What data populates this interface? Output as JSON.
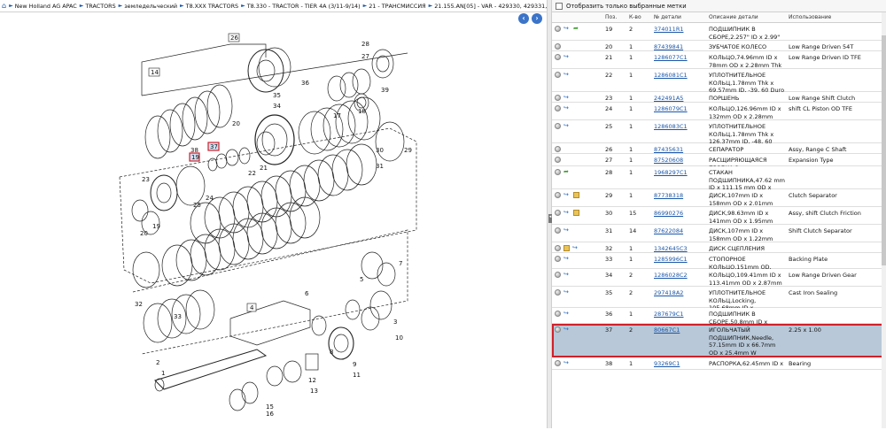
{
  "breadcrumb": {
    "items": [
      "New Holland AG APAC",
      "TRACTORS",
      "земледельческий",
      "T8.XXX TRACTORS",
      "T8.330 - TRACTOR - TIER 4A (3/11-9/14)",
      "21 - ТРАНСМИССИЯ",
      "21.155.AN[05] - VAR - 429330, 429331, 429..."
    ]
  },
  "filter": {
    "label": "Отобразить только выбранные метки"
  },
  "table": {
    "headers": {
      "pos": "Поз.",
      "qty": "К-во",
      "num": "№ детали",
      "desc": "Описание детали",
      "use": "Использование"
    },
    "rows": [
      {
        "pos": "19",
        "qty": "2",
        "num": "374011R1",
        "desc": "ПОДШИПНИК В СБОРЕ,2.257\" ID x 2.99\" OD",
        "use": "",
        "icons": [
          "dot",
          "arrow",
          "green"
        ]
      },
      {
        "pos": "20",
        "qty": "1",
        "num": "87439841",
        "desc": "ЗУБЧАТОЕ КОЛЕСО",
        "use": "Low Range Driven 54T",
        "icons": [
          "dot"
        ]
      },
      {
        "pos": "21",
        "qty": "1",
        "num": "1286077C1",
        "desc": "КОЛЬЦО,74.96mm ID x 78mm OD x 2.28mm Thk",
        "use": "Low Range Driven ID TFE",
        "icons": [
          "dot",
          "arrow"
        ]
      },
      {
        "pos": "22",
        "qty": "1",
        "num": "1286081C1",
        "desc": "УПЛОТНИТЕЛЬНОЕ КОЛЬЦ,1.78mm Thk x 69.57mm ID, -39, 60 Duro",
        "use": "",
        "icons": [
          "dot",
          "arrow"
        ]
      },
      {
        "pos": "23",
        "qty": "1",
        "num": "242491A5",
        "desc": "ПОРШЕНЬ",
        "use": "Low Range Shift Clutch",
        "icons": [
          "dot",
          "arrow"
        ]
      },
      {
        "pos": "24",
        "qty": "1",
        "num": "1286079C1",
        "desc": "КОЛЬЦО,126.96mm ID x 132mm OD x 2.28mm Thk",
        "use": "shift CL Piston OD TFE",
        "icons": [
          "dot",
          "arrow"
        ]
      },
      {
        "pos": "25",
        "qty": "1",
        "num": "1286083C1",
        "desc": "УПЛОТНИТЕЛЬНОЕ КОЛЬЦ,1.78mm Thk x 126.37mm ID, -48, 60 Duro",
        "use": "",
        "icons": [
          "dot",
          "arrow"
        ]
      },
      {
        "pos": "26",
        "qty": "1",
        "num": "87435631",
        "desc": "СЕПАРАТОР",
        "use": "Assy, Range C Shaft",
        "icons": [
          "dot"
        ]
      },
      {
        "pos": "27",
        "qty": "1",
        "num": "87520608",
        "desc": "РАСЩИРЯЮЩАЯСЯ ПРОБКА,8mm",
        "use": "Expansion Type",
        "icons": [
          "dot"
        ]
      },
      {
        "pos": "28",
        "qty": "1",
        "num": "1968297C1",
        "desc": "СТАКАН ПОДШИПНИКА,47.62 mm ID x 111.15 mm OD x 30.36 mm",
        "use": "",
        "icons": [
          "dot",
          "green"
        ]
      },
      {
        "pos": "29",
        "qty": "1",
        "num": "87738318",
        "desc": "ДИСК,107mm ID x 158mm OD x 2.01mm Thk",
        "use": "Clutch Separator",
        "icons": [
          "dot",
          "arrow",
          "box"
        ]
      },
      {
        "pos": "30",
        "qty": "15",
        "num": "86990276",
        "desc": "ДИСК,98.63mm ID x 141mm OD x 1.95mm Thk",
        "use": "Assy, shift Clutch Friction",
        "icons": [
          "dot",
          "arrow",
          "box"
        ]
      },
      {
        "pos": "31",
        "qty": "14",
        "num": "87622084",
        "desc": "ДИСК,107mm ID x 158mm OD x 1.22mm Thk",
        "use": "Shift Clutch Separator",
        "icons": [
          "dot",
          "arrow"
        ]
      },
      {
        "pos": "32",
        "qty": "1",
        "num": "1342645C3",
        "desc": "ДИСК СЦЕПЛЕНИЯ",
        "use": "",
        "icons": [
          "dot",
          "box",
          "arrow"
        ]
      },
      {
        "pos": "33",
        "qty": "1",
        "num": "1285996C1",
        "desc": "СТОПОРНОЕ КОЛЬЦО,151mm OD, Internal",
        "use": "Backing Plate",
        "icons": [
          "dot",
          "arrow"
        ]
      },
      {
        "pos": "34",
        "qty": "2",
        "num": "1286028C2",
        "desc": "КОЛЬЦО,109.41mm ID x 113.41mm OD x 2.87mm Thk",
        "use": "Low Range Driven Gear",
        "icons": [
          "dot",
          "arrow"
        ]
      },
      {
        "pos": "35",
        "qty": "2",
        "num": "297418A2",
        "desc": "УПЛОТНИТЕЛЬНОЕ КОЛЬЦ,Locking, 105.68mm ID x 113.65mm OD x 3.68mm Thk",
        "use": "Cast Iron Sealing",
        "icons": [
          "dot",
          "arrow"
        ]
      },
      {
        "pos": "36",
        "qty": "1",
        "num": "287679C1",
        "desc": "ПОДШИПНИК В СБОРЕ,50.8mm ID x 26.91mm W",
        "use": "",
        "icons": [
          "dot",
          "arrow"
        ]
      },
      {
        "pos": "37",
        "qty": "2",
        "num": "80667C1",
        "desc": "ИГОЛЬЧАТЫЙ ПОДШИПНИК,Needle, 57.15mm ID x 66.7mm OD x 25.4mm W",
        "use": "2.25 x 1.00",
        "icons": [
          "dot",
          "arrow"
        ],
        "selected": true
      },
      {
        "pos": "38",
        "qty": "1",
        "num": "93269C1",
        "desc": "РАСПОРКА,62.45mm ID x",
        "use": "Bearing",
        "icons": [
          "dot",
          "arrow"
        ]
      }
    ]
  },
  "diagram": {
    "callouts": [
      "26",
      "14",
      "28",
      "27",
      "39",
      "18",
      "36",
      "35",
      "34",
      "17",
      "37",
      "38",
      "19",
      "20",
      "22",
      "21",
      "29",
      "30",
      "23",
      "24",
      "25",
      "19",
      "20",
      "31",
      "33",
      "32",
      "7",
      "5",
      "6",
      "4",
      "3",
      "10",
      "2",
      "1",
      "8",
      "9",
      "11",
      "12",
      "13",
      "15",
      "16"
    ],
    "highlighted": [
      "37",
      "38"
    ]
  }
}
